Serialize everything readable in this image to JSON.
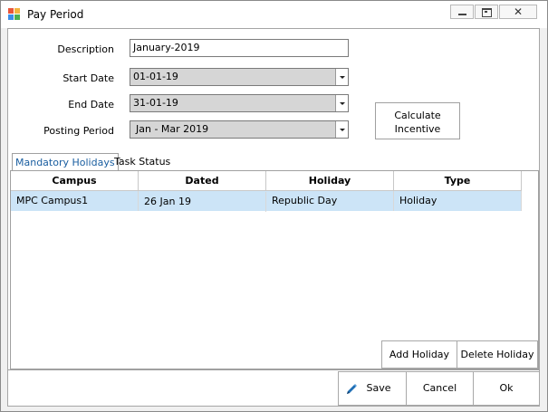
{
  "window": {
    "title": "Pay Period",
    "close_glyph": "✕"
  },
  "form": {
    "description_label": "Description",
    "description_value": "January-2019",
    "start_date_label": "Start Date",
    "start_date_value": "01-01-19",
    "end_date_label": "End Date",
    "end_date_value": "31-01-19",
    "posting_period_label": "Posting Period",
    "posting_period_value": "Jan - Mar 2019",
    "calculate_line1": "Calculate",
    "calculate_line2": "Incentive"
  },
  "tabs": [
    {
      "label": "Mandatory Holidays",
      "active": true
    },
    {
      "label": "Task Status",
      "active": false
    }
  ],
  "grid": {
    "columns": [
      "Campus",
      "Dated",
      "Holiday",
      "Type"
    ],
    "rows": [
      {
        "campus": "MPC Campus1",
        "dated": "26 Jan 19",
        "holiday": "Republic Day",
        "type": "Holiday"
      }
    ]
  },
  "panel_buttons": {
    "add_holiday": "Add Holiday",
    "delete_holiday": "Delete Holiday"
  },
  "footer_buttons": {
    "save": "Save",
    "cancel": "Cancel",
    "ok": "Ok"
  },
  "colors": {
    "selected_row": "#cce4f7",
    "active_tab_text": "#1a5ea0",
    "pencil": "#1f6fb5"
  }
}
